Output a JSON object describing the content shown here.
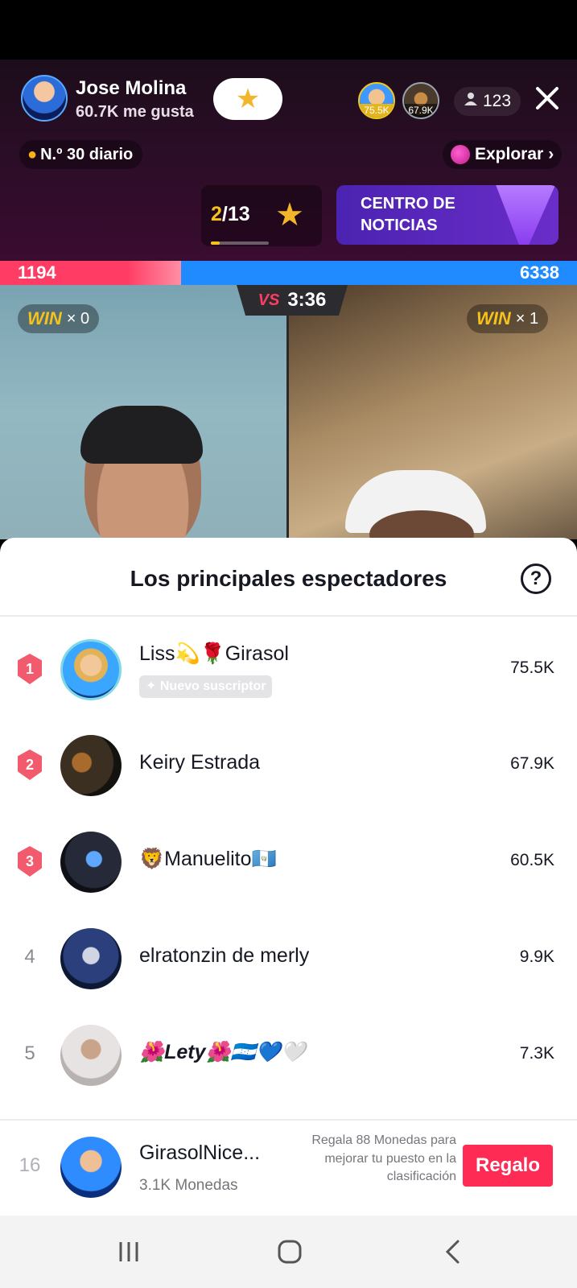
{
  "host": {
    "name": "Jose Molina",
    "likes": "60.7K me gusta",
    "viewer_count": "123"
  },
  "top_viewers_preview": [
    {
      "badge": "75.5K"
    },
    {
      "badge": "67.9K"
    }
  ],
  "daily_rank": "N.º 30 diario",
  "explore_label": "Explorar",
  "goal": {
    "current": "2",
    "total": "/13",
    "progress": 0.15
  },
  "news_card": {
    "label": "CENTRO DE NOTICIAS"
  },
  "battle": {
    "score_left": "1194",
    "score_right": "6338",
    "timer": "3:36",
    "vs_label": "VS",
    "win_label": "WIN",
    "left_wins": "× 0",
    "right_wins": "× 1"
  },
  "sheet": {
    "title": "Los principales espectadores",
    "rows": [
      {
        "rank": "1",
        "name": "Liss💫🌹Girasol",
        "value": "75.5K",
        "badge": "Nuevo suscriptor"
      },
      {
        "rank": "2",
        "name": "Keiry Estrada",
        "value": "67.9K"
      },
      {
        "rank": "3",
        "name": "🦁Manuelito🇬🇹",
        "value": "60.5K"
      },
      {
        "rank": "4",
        "name": "elratonzin  de merly",
        "value": "9.9K"
      },
      {
        "rank": "5",
        "name": "🌺Lety🌺🇭🇳💙🤍",
        "value": "7.3K"
      }
    ],
    "self": {
      "rank": "16",
      "name": "GirasolNice...",
      "coins": "3.1K Monedas",
      "hint": "Regala 88 Monedas para mejorar tu puesto en la clasificación",
      "gift_label": "Regalo"
    }
  },
  "colors": {
    "accent": "#fe2c55",
    "battle_red": "#ff3c63",
    "battle_blue": "#1f8bff",
    "gold": "#f5c21b"
  },
  "icons": [
    "star-icon",
    "person-icon",
    "close-icon",
    "flame-icon",
    "planet-icon",
    "chevron-right-icon",
    "help-icon",
    "recents-icon",
    "home-icon",
    "back-icon"
  ]
}
